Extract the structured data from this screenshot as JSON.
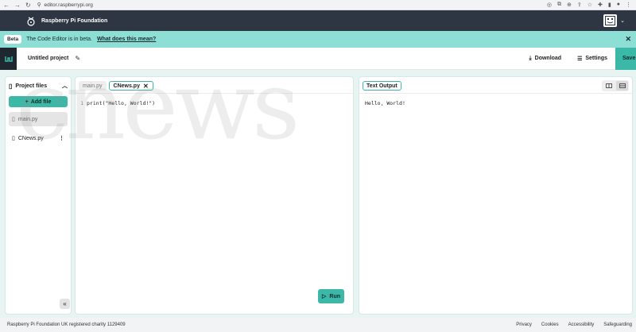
{
  "browser": {
    "url": "editor.raspberrypi.org"
  },
  "site_header": {
    "brand": "Raspberry Pi Foundation"
  },
  "beta_banner": {
    "pill": "Beta",
    "message": "The Code Editor is in beta.",
    "link": "What does this mean?"
  },
  "project_bar": {
    "title": "Untitled project",
    "download_label": "Download",
    "settings_label": "Settings",
    "save_label": "Save"
  },
  "sidebar": {
    "title": "Project files",
    "add_file_label": "Add file",
    "files": [
      {
        "name": "main.py"
      },
      {
        "name": "CNews.py"
      }
    ]
  },
  "editor": {
    "tabs": [
      {
        "label": "main.py"
      },
      {
        "label": "CNews.py"
      }
    ],
    "line_number": "1",
    "code": "print(\"Hello, World!\")",
    "run_label": "Run"
  },
  "output": {
    "tab_label": "Text Output",
    "text": "Hello, World!"
  },
  "footer": {
    "charity": "Raspberry Pi Foundation UK registered charity 1129409",
    "links": [
      "Privacy",
      "Cookies",
      "Accessibility",
      "Safeguarding"
    ]
  },
  "watermark": "cnews",
  "colors": {
    "header_bg": "#2e3643",
    "banner_bg": "#8ddfd6",
    "accent": "#3bb8a8"
  }
}
